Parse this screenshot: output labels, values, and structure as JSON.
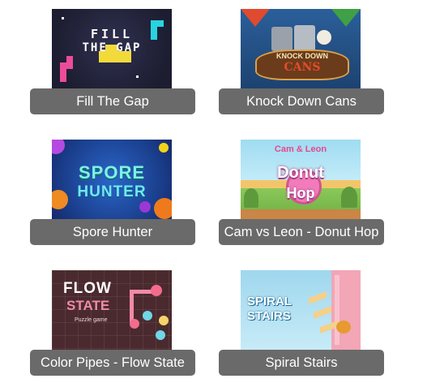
{
  "games": [
    {
      "id": "fill-the-gap",
      "title": "Fill The Gap",
      "thumb_text": [
        "FILL",
        "THE GAP"
      ]
    },
    {
      "id": "knock-down-cans",
      "title": "Knock Down Cans",
      "thumb_text": [
        "KNOCK DOWN",
        "CANS"
      ]
    },
    {
      "id": "spore-hunter",
      "title": "Spore Hunter",
      "thumb_text": [
        "SPORE",
        "HUNTER"
      ]
    },
    {
      "id": "donut-hop",
      "title": "Cam vs Leon - Donut Hop",
      "thumb_text": [
        "Cam & Leon",
        "Donut",
        "Hop"
      ]
    },
    {
      "id": "flow-state",
      "title": "Color Pipes - Flow State",
      "thumb_text": [
        "FLOW",
        "STATE",
        "Puzzle game"
      ]
    },
    {
      "id": "spiral-stairs",
      "title": "Spiral Stairs",
      "thumb_text": [
        "SPIRAL",
        "STAIRS"
      ]
    }
  ],
  "colors": {
    "label_bg": "#6a6a6a",
    "label_text": "#ffffff"
  }
}
